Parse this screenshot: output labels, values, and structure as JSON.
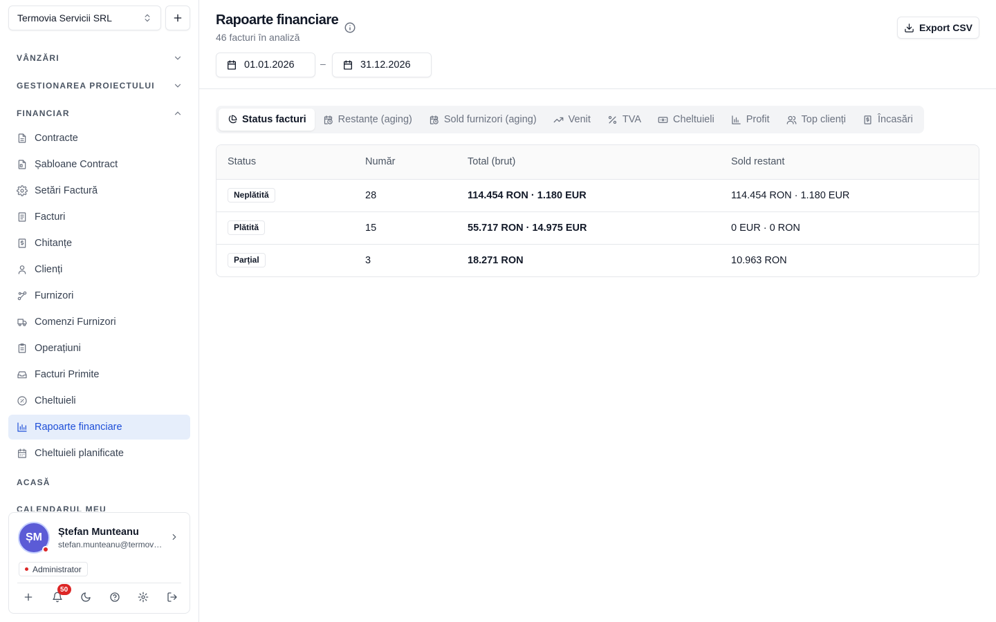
{
  "sidebar": {
    "org_name": "Termovia Servicii SRL",
    "sections": {
      "sales": "VÂNZĂRI",
      "projects": "GESTIONAREA PROIECTULUI",
      "financial": "FINANCIAR",
      "home": "ACASĂ",
      "calendar": "CALENDARUL MEU"
    },
    "items": [
      {
        "label": "Contracte",
        "icon": "file-text-icon"
      },
      {
        "label": "Șabloane Contract",
        "icon": "file-template-icon"
      },
      {
        "label": "Setări Factură",
        "icon": "gear-icon"
      },
      {
        "label": "Facturi",
        "icon": "invoice-icon"
      },
      {
        "label": "Chitanțe",
        "icon": "receipt-icon"
      },
      {
        "label": "Clienți",
        "icon": "user-icon"
      },
      {
        "label": "Furnizori",
        "icon": "supplier-icon"
      },
      {
        "label": "Comenzi Furnizori",
        "icon": "truck-icon"
      },
      {
        "label": "Operațiuni",
        "icon": "clipboard-icon"
      },
      {
        "label": "Facturi Primite",
        "icon": "inbox-icon"
      },
      {
        "label": "Cheltuieli",
        "icon": "expense-icon"
      },
      {
        "label": "Rapoarte financiare",
        "icon": "bar-chart-icon",
        "active": true
      },
      {
        "label": "Cheltuieli planificate",
        "icon": "calendar-icon"
      }
    ],
    "user": {
      "initials": "ȘM",
      "name": "Ștefan Munteanu",
      "email": "stefan.munteanu@termovia.ro",
      "role": "Administrator",
      "notifications": "50"
    }
  },
  "header": {
    "title": "Rapoarte financiare",
    "subtitle": "46 facturi în analiză",
    "export_label": "Export CSV",
    "date_from": "01.01.2026",
    "date_sep": "–",
    "date_to": "31.12.2026"
  },
  "tabs": [
    {
      "label": "Status facturi",
      "icon": "pie-chart-icon",
      "active": true
    },
    {
      "label": "Restanțe (aging)",
      "icon": "calendar-clock-icon"
    },
    {
      "label": "Sold furnizori (aging)",
      "icon": "calendar-clock-icon"
    },
    {
      "label": "Venit",
      "icon": "trend-up-icon"
    },
    {
      "label": "TVA",
      "icon": "percent-icon"
    },
    {
      "label": "Cheltuieli",
      "icon": "banknote-icon"
    },
    {
      "label": "Profit",
      "icon": "bar-chart-icon"
    },
    {
      "label": "Top clienți",
      "icon": "users-icon"
    },
    {
      "label": "Încasări",
      "icon": "receipt-icon"
    }
  ],
  "table": {
    "columns": [
      "Status",
      "Număr",
      "Total (brut)",
      "Sold restant"
    ],
    "rows": [
      {
        "status": "Neplătită",
        "count": "28",
        "total": "114.454 RON · 1.180 EUR",
        "balance": "114.454 RON · 1.180 EUR"
      },
      {
        "status": "Plătită",
        "count": "15",
        "total": "55.717 RON · 14.975 EUR",
        "balance": "0 EUR · 0 RON"
      },
      {
        "status": "Parțial",
        "count": "3",
        "total": "18.271 RON",
        "balance": "10.963 RON"
      }
    ]
  },
  "colors": {
    "accent": "#1d4ed8",
    "active_bg": "#e6eefb",
    "avatar": "#5b5bd6",
    "alert": "#dc2626"
  }
}
